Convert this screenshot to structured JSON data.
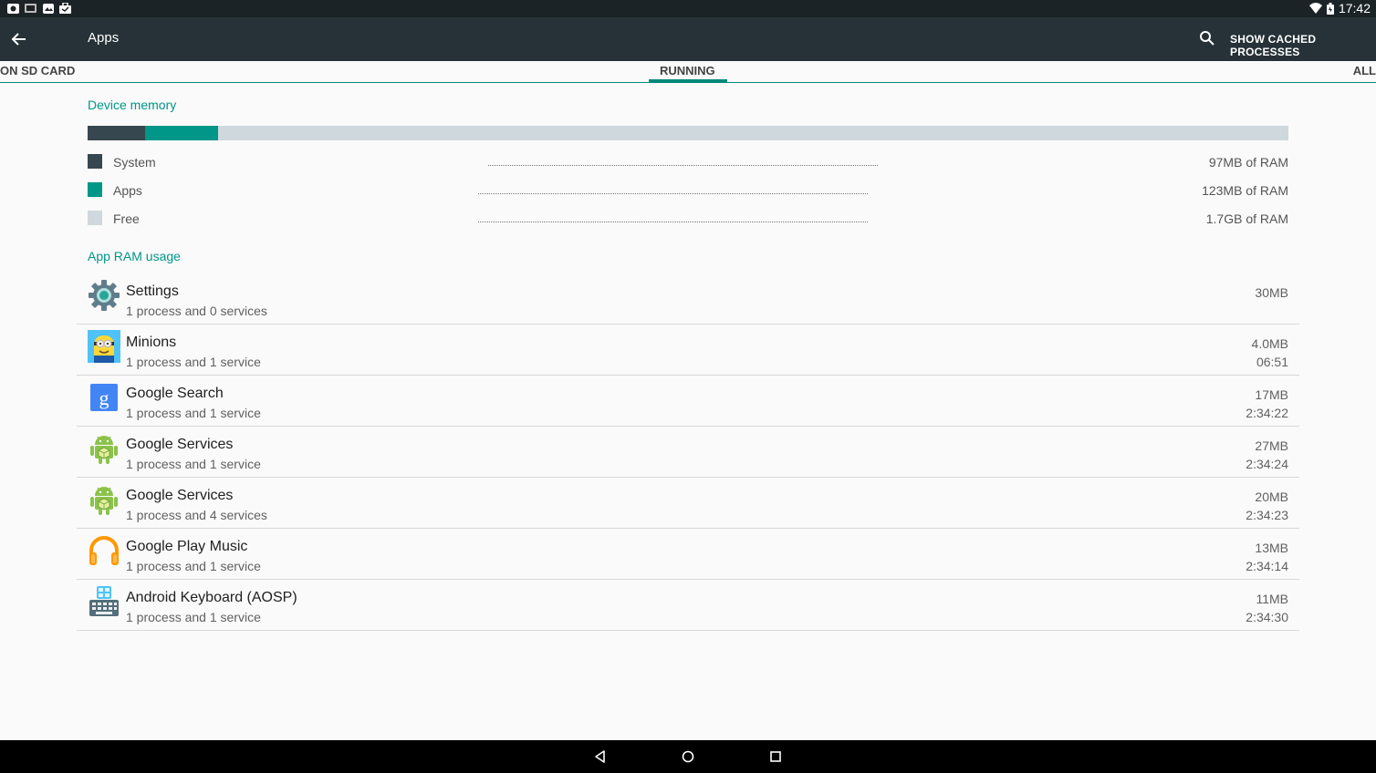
{
  "status_bar": {
    "time": "17:42"
  },
  "toolbar": {
    "title": "Apps",
    "action_label": "SHOW CACHED PROCESSES"
  },
  "tabs": {
    "left": "ON SD CARD",
    "active": "RUNNING",
    "right": "ALL"
  },
  "device_memory": {
    "heading": "Device memory",
    "usage_fractions": {
      "system": 0.048,
      "apps": 0.061,
      "free": 0.891
    },
    "legend": [
      {
        "label": "System",
        "value": "97MB of RAM",
        "color": "#37474f"
      },
      {
        "label": "Apps",
        "value": "123MB of RAM",
        "color": "#009688"
      },
      {
        "label": "Free",
        "value": "1.7GB of RAM",
        "color": "#cfd8dc"
      }
    ]
  },
  "app_ram": {
    "heading": "App RAM usage",
    "apps": [
      {
        "name": "Settings",
        "detail": "1 process and 0 services",
        "memory": "30MB",
        "time": "",
        "icon": "settings-gear-icon"
      },
      {
        "name": "Minions",
        "detail": "1 process and 1 service",
        "memory": "4.0MB",
        "time": "06:51",
        "icon": "minion-icon"
      },
      {
        "name": "Google Search",
        "detail": "1 process and 1 service",
        "memory": "17MB",
        "time": "2:34:22",
        "icon": "google-search-icon"
      },
      {
        "name": "Google Services",
        "detail": "1 process and 1 service",
        "memory": "27MB",
        "time": "2:34:24",
        "icon": "android-robot-icon"
      },
      {
        "name": "Google Services",
        "detail": "1 process and 4 services",
        "memory": "20MB",
        "time": "2:34:23",
        "icon": "android-robot-icon"
      },
      {
        "name": "Google Play Music",
        "detail": "1 process and 1 service",
        "memory": "13MB",
        "time": "2:34:14",
        "icon": "headphones-icon"
      },
      {
        "name": "Android Keyboard (AOSP)",
        "detail": "1 process and 1 service",
        "memory": "11MB",
        "time": "2:34:30",
        "icon": "keyboard-icon"
      }
    ]
  },
  "colors": {
    "toolbar": "#263238",
    "accent": "#009688",
    "status_bar": "#1c2326"
  }
}
